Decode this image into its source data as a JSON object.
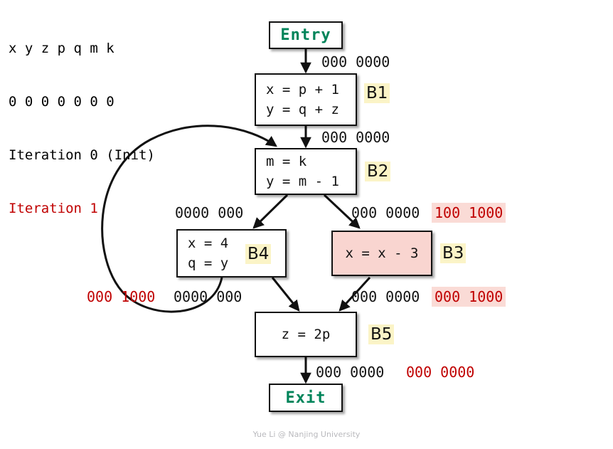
{
  "legend": {
    "variables": "x y z p q m k",
    "values": "0 0 0 0 0 0 0",
    "iteration_init": "Iteration 0 (Init)",
    "iteration_one": "Iteration 1",
    "init_color": "#000000",
    "iter1_color": "#c00000"
  },
  "nodes": {
    "entry": {
      "label": "Entry"
    },
    "exit": {
      "label": "Exit"
    },
    "b1": {
      "id": "B1",
      "stmt1": "x = p + 1",
      "stmt2": "y = q + z"
    },
    "b2": {
      "id": "B2",
      "stmt1": "m = k",
      "stmt2": "y = m - 1"
    },
    "b4": {
      "id": "B4",
      "stmt1": "x = 4",
      "stmt2": "q = y"
    },
    "b3": {
      "id": "B3",
      "stmt1": "x = x - 3"
    },
    "b5": {
      "id": "B5",
      "stmt1": "z = 2p"
    }
  },
  "facts": {
    "entry_to_b1": "000 0000",
    "b1_to_b2": "000 0000",
    "b2_to_b4": "0000 000",
    "b2_to_b3_black": "000 0000",
    "b2_to_b3_red": "100 1000",
    "b4_out_red": "000 1000",
    "b4_out_black": "0000 000",
    "b3_out_black": "000 0000",
    "b3_out_red": "000 1000",
    "b5_out_black": "000 0000",
    "b5_out_red": "000 0000"
  },
  "footer": {
    "credit": "Yue Li @ Nanjing University"
  },
  "colors": {
    "accent_green": "#00845a",
    "red": "#c00000",
    "pink_fill": "#f9d5d0",
    "pink_highlight": "#fadbd6",
    "yellow_highlight": "#fbf4c7",
    "stroke": "#111111"
  }
}
